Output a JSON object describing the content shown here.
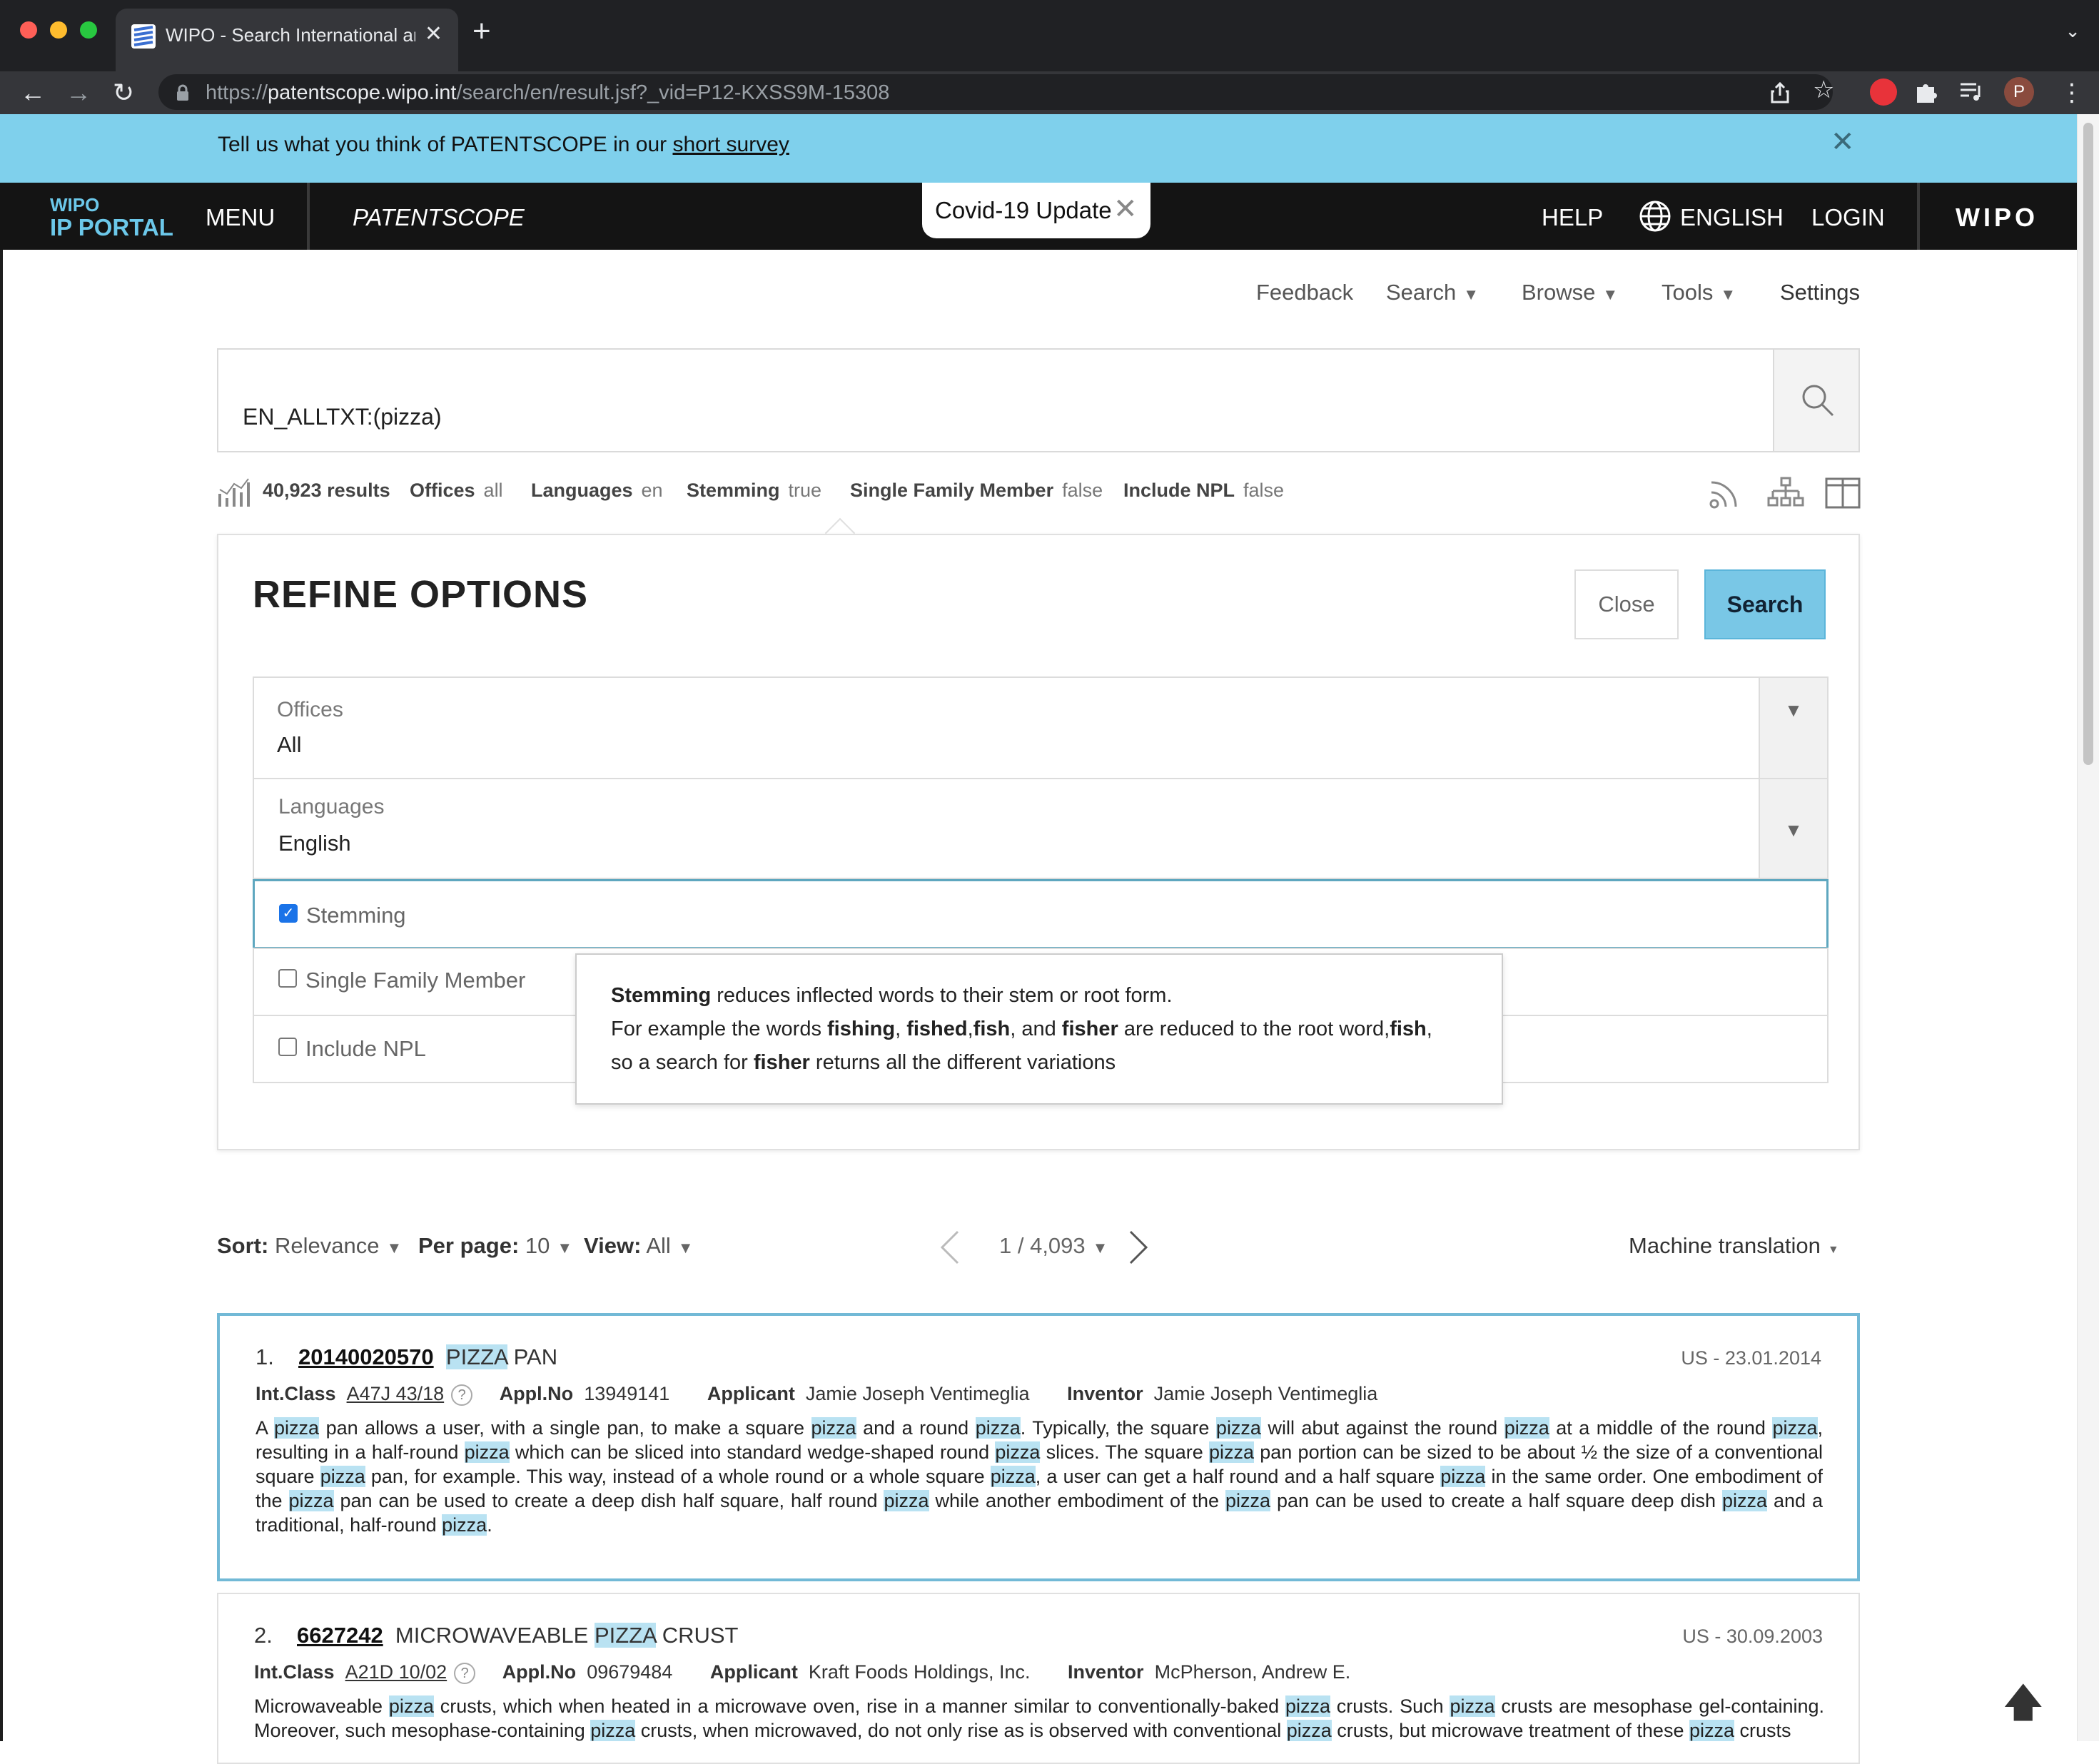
{
  "browser": {
    "tab_title": "WIPO - Search International an",
    "tab_close": "✕",
    "new_tab": "+",
    "tab_menu": "⌄",
    "back": "←",
    "forward": "→",
    "reload": "↻",
    "url_prefix": "https://",
    "url_host": "patentscope.wipo.int",
    "url_path": "/search/en/result.jsf?_vid=P12-KXSS9M-15308",
    "profile_initial": "P"
  },
  "survey": {
    "text": "Tell us what you think of PATENTSCOPE in our ",
    "link": "short survey",
    "close": "✕"
  },
  "header": {
    "logo_top": "WIPO",
    "logo_bottom": "IP PORTAL",
    "menu": "MENU",
    "app_name": "PATENTSCOPE",
    "covid": "Covid-19 Update",
    "covid_close": "✕",
    "help": "HELP",
    "language": "ENGLISH",
    "login": "LOGIN",
    "wipo": "WIPO"
  },
  "subnav": {
    "feedback": "Feedback",
    "search": "Search",
    "browse": "Browse",
    "tools": "Tools",
    "settings": "Settings"
  },
  "search": {
    "query": "EN_ALLTXT:(pizza)"
  },
  "stats": {
    "results": "40,923 results",
    "offices_label": "Offices",
    "offices_value": "all",
    "languages_label": "Languages",
    "languages_value": "en",
    "stemming_label": "Stemming",
    "stemming_value": "true",
    "sfm_label": "Single Family Member",
    "sfm_value": "false",
    "npl_label": "Include NPL",
    "npl_value": "false"
  },
  "refine": {
    "title": "REFINE OPTIONS",
    "close": "Close",
    "search": "Search",
    "offices_label": "Offices",
    "offices_value": "All",
    "languages_label": "Languages",
    "languages_value": "English",
    "stemming": "Stemming",
    "stemming_checked": true,
    "single_family": "Single Family Member",
    "single_family_checked": false,
    "include_npl": "Include NPL",
    "include_npl_checked": false
  },
  "tooltip": {
    "line1_bold": "Stemming",
    "line1_rest": " reduces inflected words to their stem or root form.",
    "line2_a": "For example the words ",
    "w_fishing": "fishing",
    "sep1": ", ",
    "w_fished": "fished",
    "sep2": ",",
    "w_fish": "fish",
    "sep3": ", and ",
    "w_fisher": "fisher",
    "line2_b": " are reduced to the root word,",
    "w_fish2": "fish",
    "line2_end": ",",
    "line3_a": "so a search for ",
    "w_fisher2": "fisher",
    "line3_b": " returns all the different variations"
  },
  "sortbar": {
    "sort_label": "Sort:",
    "sort_value": "Relevance",
    "perpage_label": "Per page:",
    "perpage_value": "10",
    "view_label": "View:",
    "view_value": "All",
    "page": "1 / 4,093",
    "machine_translation": "Machine translation"
  },
  "results": [
    {
      "num": "1.",
      "id": "20140020570",
      "title_hl": "PIZZA",
      "title_rest": " PAN",
      "date": "US - 23.01.2014",
      "intclass_label": "Int.Class",
      "intclass": "A47J 43/18",
      "applno_label": "Appl.No",
      "applno": "13949141",
      "applicant_label": "Applicant",
      "applicant": "Jamie Joseph Ventimeglia",
      "inventor_label": "Inventor",
      "inventor": "Jamie Joseph Ventimeglia",
      "abstract": "A pizza pan allows a user, with a single pan, to make a square pizza and a round pizza. Typically, the square pizza will abut against the round pizza at a middle of the round pizza, resulting in a half-round pizza which can be sliced into standard wedge-shaped round pizza slices. The square pizza pan portion can be sized to be about ½ the size of a conventional square pizza pan, for example. This way, instead of a whole round or a whole square pizza, a user can get a half round and a half square pizza in the same order. One embodiment of the pizza pan can be used to create a deep dish half square, half round pizza while another embodiment of the pizza pan can be used to create a half square deep dish pizza and a traditional, half-round pizza."
    },
    {
      "num": "2.",
      "id": "6627242",
      "title_pre": "MICROWAVEABLE ",
      "title_hl": "PIZZA",
      "title_rest": " CRUST",
      "date": "US - 30.09.2003",
      "intclass_label": "Int.Class",
      "intclass": "A21D 10/02",
      "applno_label": "Appl.No",
      "applno": "09679484",
      "applicant_label": "Applicant",
      "applicant": "Kraft Foods Holdings, Inc.",
      "inventor_label": "Inventor",
      "inventor": "McPherson, Andrew E.",
      "abstract": "Microwaveable pizza crusts, which when heated in a microwave oven, rise in a manner similar to conventionally-baked pizza crusts. Such pizza crusts are mesophase gel-containing. Moreover, such mesophase-containing pizza crusts, when microwaved, do not only rise as is observed with conventional pizza crusts, but microwave treatment of these pizza crusts"
    }
  ],
  "colors": {
    "survey_bg": "#7fd0ec",
    "header_bg": "#141414",
    "accent": "#79c7e6",
    "highlight": "#b9e2f2"
  },
  "icons": [
    "patentscope-favicon",
    "lock-icon",
    "share-icon",
    "star-icon",
    "extension-icon",
    "puzzle-icon",
    "media-icon",
    "kebab-icon",
    "globe-icon",
    "search-icon",
    "chart-icon",
    "rss-icon",
    "tree-icon",
    "split-view-icon",
    "arrow-up-icon"
  ]
}
